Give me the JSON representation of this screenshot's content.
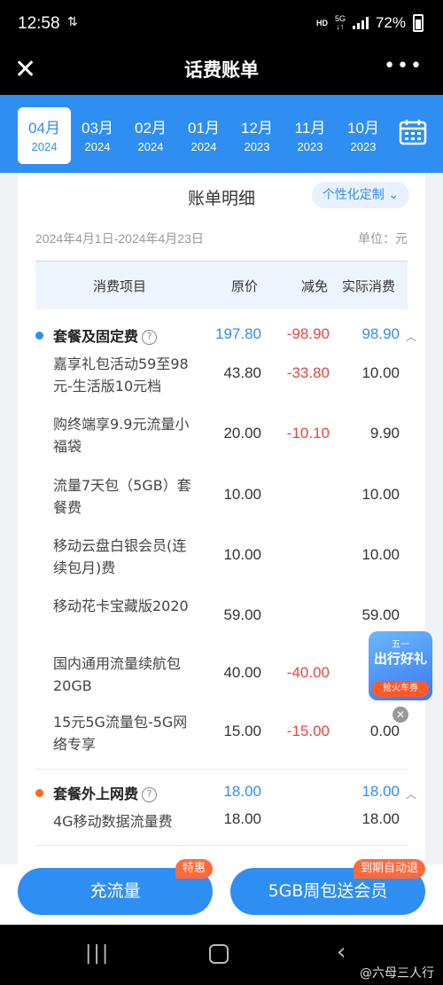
{
  "status": {
    "time": "12:58",
    "hd": "HD",
    "net": "5G",
    "battery": "72%"
  },
  "header": {
    "title": "话费账单"
  },
  "months": [
    {
      "m": "04月",
      "y": "2024",
      "active": true
    },
    {
      "m": "03月",
      "y": "2024"
    },
    {
      "m": "02月",
      "y": "2024"
    },
    {
      "m": "01月",
      "y": "2024"
    },
    {
      "m": "12月",
      "y": "2023"
    },
    {
      "m": "11月",
      "y": "2023"
    },
    {
      "m": "10月",
      "y": "2023"
    }
  ],
  "detail": {
    "title": "账单明细",
    "custom_label": "个性化定制",
    "period": "2024年4月1日-2024年4月23日",
    "unit": "单位：元",
    "columns": {
      "item": "消费项目",
      "original": "原价",
      "discount": "减免",
      "actual": "实际消费"
    },
    "groups": [
      {
        "name": "套餐及固定费",
        "original": "197.80",
        "discount": "-98.90",
        "actual": "98.90",
        "dot": "#2f8ef2",
        "items": [
          {
            "name": "嘉享礼包活动59至98元-生活版10元档",
            "original": "43.80",
            "discount": "-33.80",
            "actual": "10.00"
          },
          {
            "name": "购终端享9.9元流量小福袋",
            "original": "20.00",
            "discount": "-10.10",
            "actual": "9.90"
          },
          {
            "name": "流量7天包（5GB）套餐费",
            "original": "10.00",
            "discount": "",
            "actual": "10.00"
          },
          {
            "name": "移动云盘白银会员(连续包月)费",
            "original": "10.00",
            "discount": "",
            "actual": "10.00"
          },
          {
            "name": "移动花卡宝藏版2020",
            "original": "59.00",
            "discount": "",
            "actual": "59.00"
          },
          {
            "name": "国内通用流量续航包20GB",
            "original": "40.00",
            "discount": "-40.00",
            "actual": ""
          },
          {
            "name": "15元5G流量包-5G网络专享",
            "original": "15.00",
            "discount": "-15.00",
            "actual": "0.00"
          }
        ]
      },
      {
        "name": "套餐外上网费",
        "original": "18.00",
        "discount": "",
        "actual": "18.00",
        "dot": "#ff6a1a",
        "items": [
          {
            "name": "4G移动数据流量费",
            "original": "18.00",
            "discount": "",
            "actual": "18.00"
          }
        ]
      }
    ]
  },
  "promo": {
    "top": "五一",
    "main": "出行好礼",
    "button": "抢火车券"
  },
  "actions": {
    "recharge": "充流量",
    "recharge_tag": "特惠",
    "weekly": "5GB周包送会员",
    "weekly_tag": "到期自动退"
  },
  "watermark": "@六母三人行",
  "colors": {
    "accent": "#2f8ef2",
    "discount": "#e8453c",
    "tag": "#ff6a3d"
  }
}
